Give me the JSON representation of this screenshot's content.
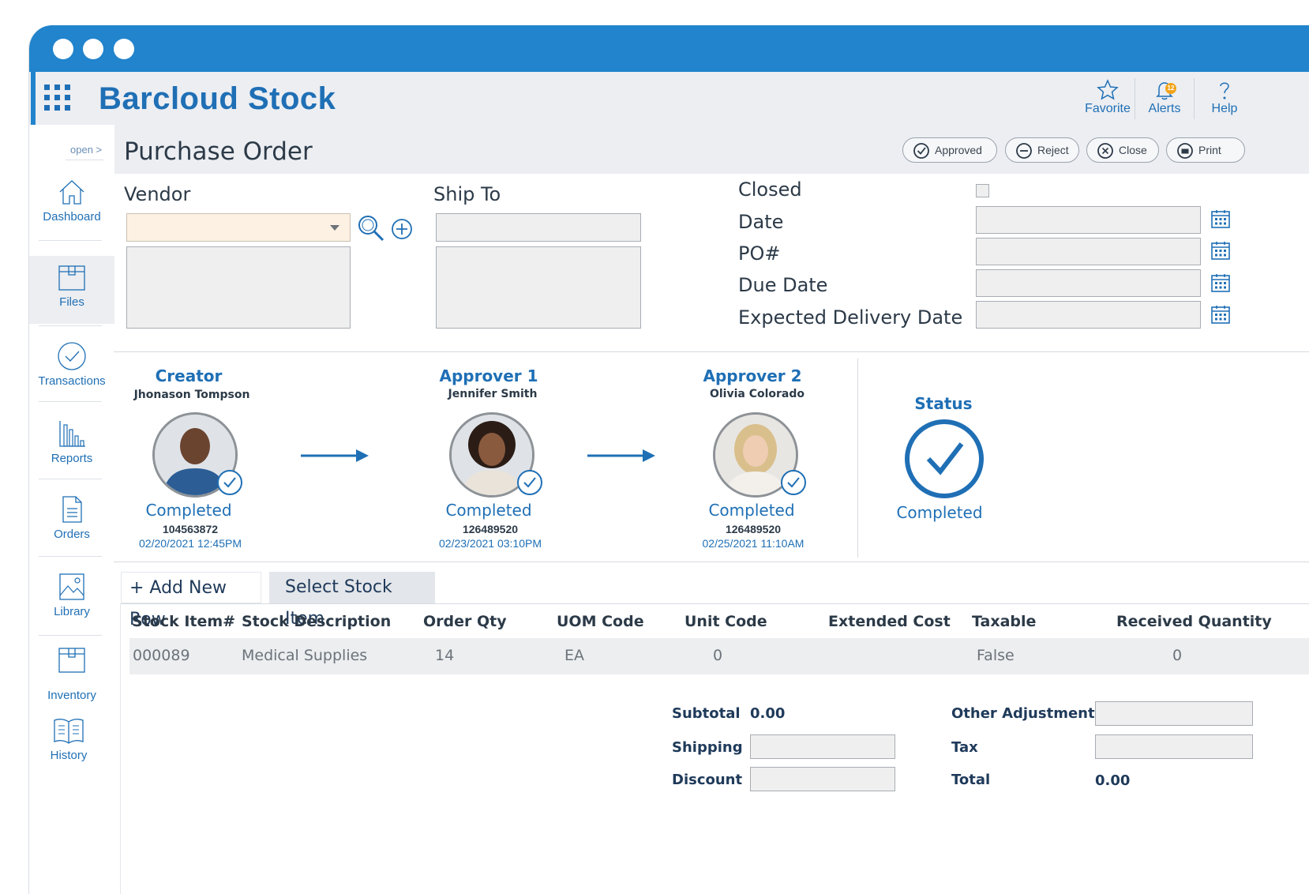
{
  "app": {
    "title": "Barcloud Stock"
  },
  "topbar": {
    "favorite": "Favorite",
    "alerts": "Alerts",
    "alerts_count": "12",
    "help": "Help"
  },
  "sidebar": {
    "open": "open >",
    "items": [
      {
        "label": "Dashboard",
        "icon": "home-icon"
      },
      {
        "label": "Files",
        "icon": "box-icon"
      },
      {
        "label": "Transactions",
        "icon": "check-circle-icon"
      },
      {
        "label": "Reports",
        "icon": "bar-chart-icon"
      },
      {
        "label": "Orders",
        "icon": "document-icon"
      },
      {
        "label": "Library",
        "icon": "image-icon"
      },
      {
        "label": "Inventory",
        "icon": "box-icon"
      },
      {
        "label": "History",
        "icon": "book-icon"
      }
    ]
  },
  "header": {
    "title": "Purchase Order",
    "actions": {
      "approved": "Approved",
      "reject": "Reject",
      "close": "Close",
      "print": "Print"
    }
  },
  "form": {
    "vendor": "Vendor",
    "ship_to": "Ship To",
    "closed": "Closed",
    "date": "Date",
    "po": "PO#",
    "due_date": "Due Date",
    "expected_delivery": "Expected Delivery Date"
  },
  "workflow": {
    "steps": [
      {
        "role": "Creator",
        "name": "Jhonason Tompson",
        "status": "Completed",
        "id": "104563872",
        "date": "02/20/2021 12:45PM"
      },
      {
        "role": "Approver 1",
        "name": "Jennifer Smith",
        "status": "Completed",
        "id": "126489520",
        "date": "02/23/2021 03:10PM"
      },
      {
        "role": "Approver 2",
        "name": "Olivia Colorado",
        "status": "Completed",
        "id": "126489520",
        "date": "02/25/2021 11:10AM"
      }
    ],
    "status_label": "Status",
    "status_value": "Completed"
  },
  "grid": {
    "add_row": "+ Add New Row",
    "select_item": "Select Stock Item",
    "columns": [
      "Stock Item#",
      "Stock Description",
      "Order Qty",
      "UOM Code",
      "Unit Code",
      "Extended Cost",
      "Taxable",
      "Received Quantity"
    ],
    "rows": [
      [
        "000089",
        "Medical Supplies",
        "14",
        "EA",
        "0",
        "",
        "False",
        "0"
      ]
    ]
  },
  "totals": {
    "subtotal_label": "Subtotal",
    "subtotal": "0.00",
    "shipping_label": "Shipping",
    "discount_label": "Discount",
    "other_adjustment_label": "Other Adjustment",
    "tax_label": "Tax",
    "total_label": "Total",
    "total": "0.00"
  },
  "colors": {
    "accent": "#2184cc",
    "brand_text": "#1f6fb5",
    "panel": "#eceef2"
  }
}
